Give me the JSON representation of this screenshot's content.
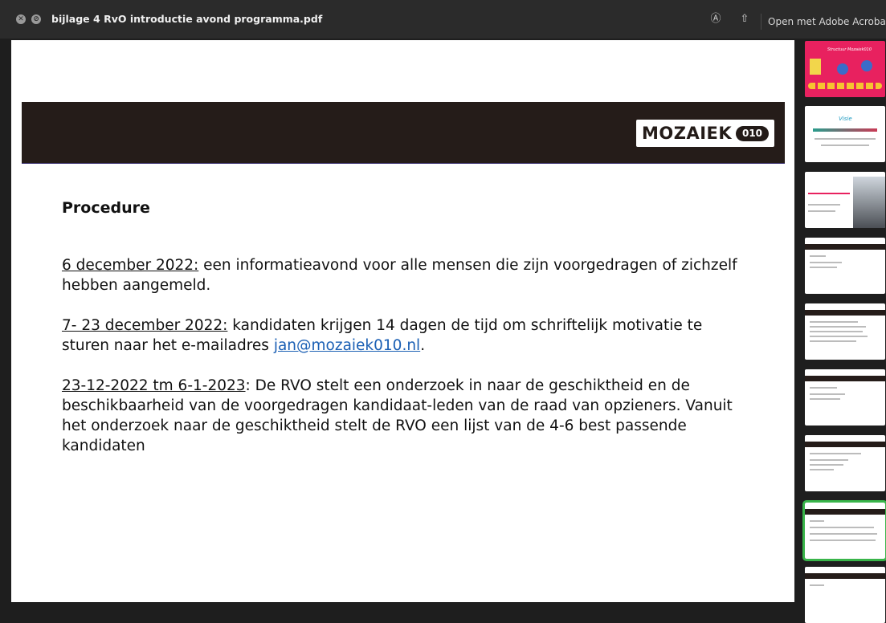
{
  "window": {
    "title": "bijlage 4 RvO introductie avond programma.pdf",
    "open_with_label": "Open met Adobe Acrobat",
    "icons": [
      "close-icon",
      "minimize-icon",
      "markup-icon",
      "share-icon"
    ]
  },
  "document": {
    "logo_text": "MOZAIEK",
    "logo_badge": "010",
    "heading": "Procedure",
    "paragraphs": [
      {
        "date": "6 december 2022:",
        "text": " een informatieavond voor alle mensen die zijn voorgedragen of zichzelf hebben aangemeld."
      },
      {
        "date": "7- 23 december 2022:",
        "text": " kandidaten krijgen 14 dagen de tijd om schriftelijk motivatie te sturen naar het e-mailadres ",
        "link": "jan@mozaiek010.nl",
        "after": "."
      },
      {
        "date": "23-12-2022 tm 6-1-2023",
        "text": ": De RVO stelt een onderzoek in naar de geschiktheid en de beschikbaarheid van de voorgedragen kandidaat-leden van de raad van opzieners. Vanuit het onderzoek naar de geschiktheid stelt de RVO een lijst van de 4-6 best passende kandidaten"
      }
    ]
  },
  "colors": {
    "banner": "#251c19",
    "link": "#1a5fb4",
    "selected_thumb": "#39b54a",
    "thumb_pink": "#e8215f"
  },
  "thumbnails": {
    "count": 9,
    "selected_index": 7,
    "thumb_1_title": "Structuur Mozaiek010",
    "thumb_2_title": "Visie"
  }
}
